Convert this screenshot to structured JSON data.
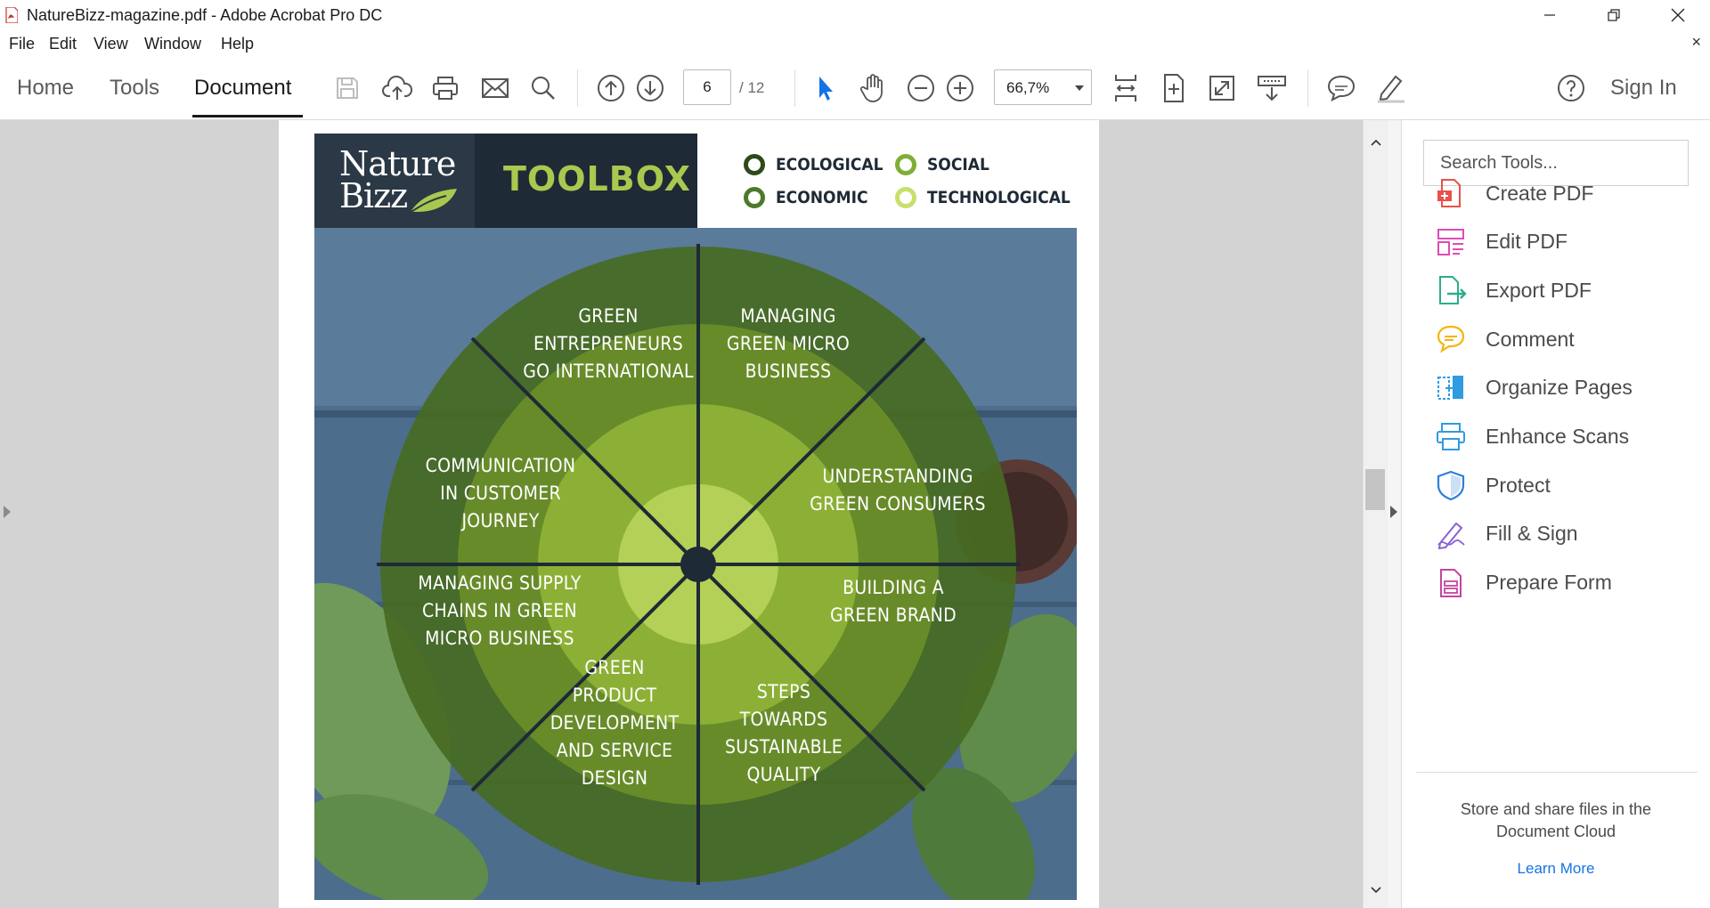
{
  "window": {
    "title": "NatureBizz-magazine.pdf - Adobe Acrobat Pro DC",
    "icon": "pdf-file-icon"
  },
  "menu": [
    "File",
    "Edit",
    "View",
    "Window",
    "Help"
  ],
  "toolbar": {
    "tabs": [
      "Home",
      "Tools",
      "Document"
    ],
    "active_tab": "Document",
    "page_current": "6",
    "page_total": "/ 12",
    "zoom": "66,7%",
    "sign_in": "Sign In"
  },
  "tools_pane": {
    "search_placeholder": "Search Tools...",
    "items": [
      {
        "label": "Create PDF",
        "icon": "create-pdf-icon",
        "color": "#e8514b"
      },
      {
        "label": "Edit PDF",
        "icon": "edit-pdf-icon",
        "color": "#e04bb3"
      },
      {
        "label": "Export PDF",
        "icon": "export-pdf-icon",
        "color": "#2bae8a"
      },
      {
        "label": "Comment",
        "icon": "comment-icon",
        "color": "#f5b50f"
      },
      {
        "label": "Organize Pages",
        "icon": "organize-pages-icon",
        "color": "#2f9be0"
      },
      {
        "label": "Enhance Scans",
        "icon": "enhance-scans-icon",
        "color": "#2f9be0"
      },
      {
        "label": "Protect",
        "icon": "protect-icon",
        "color": "#2f7fd6"
      },
      {
        "label": "Fill & Sign",
        "icon": "fill-sign-icon",
        "color": "#8a5fd6"
      },
      {
        "label": "Prepare Form",
        "icon": "prepare-form-icon",
        "color": "#c545a0"
      }
    ],
    "cloud_text": "Store and share files in the Document Cloud",
    "learn_more": "Learn More"
  },
  "magazine": {
    "logo_line1": "Nature",
    "logo_line2": "Bizz",
    "header_title": "TOOLBOX",
    "legend": [
      {
        "label": "ECOLOGICAL",
        "color": "#2e4a1a"
      },
      {
        "label": "SOCIAL",
        "color": "#7fae36"
      },
      {
        "label": "ECONOMIC",
        "color": "#4c7a2a"
      },
      {
        "label": "TECHNOLOGICAL",
        "color": "#c7e06a"
      }
    ],
    "wheel_segments": [
      [
        "GREEN",
        "ENTREPRENEURS",
        "GO INTERNATIONAL"
      ],
      [
        "MANAGING",
        "GREEN MICRO",
        "BUSINESS"
      ],
      [
        "UNDERSTANDING",
        "GREEN CONSUMERS"
      ],
      [
        "BUILDING A",
        "GREEN BRAND"
      ],
      [
        "STEPS",
        "TOWARDS",
        "SUSTAINABLE",
        "QUALITY"
      ],
      [
        "GREEN",
        "PRODUCT",
        "DEVELOPMENT",
        "AND SERVICE",
        "DESIGN"
      ],
      [
        "MANAGING SUPPLY",
        "CHAINS IN GREEN",
        "MICRO BUSINESS"
      ],
      [
        "COMMUNICATION",
        "IN CUSTOMER",
        "JOURNEY"
      ]
    ]
  }
}
